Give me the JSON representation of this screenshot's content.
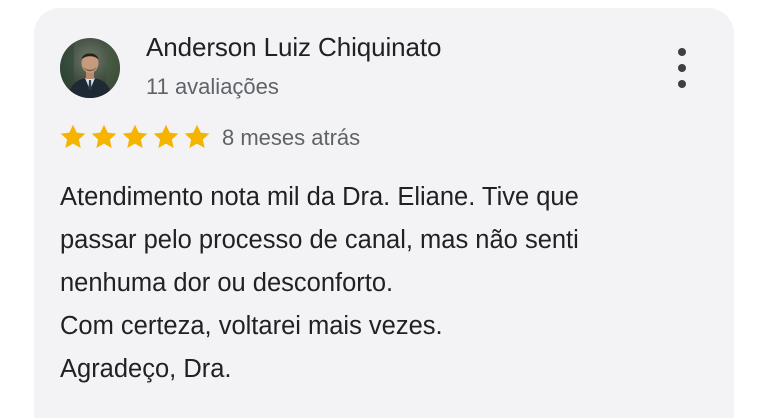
{
  "review": {
    "author_name": "Anderson Luiz Chiquinato",
    "reviews_count": "11 avaliações",
    "rating": 5,
    "max_rating": 5,
    "time_ago": "8 meses atrás",
    "text_lines": [
      "Atendimento nota mil da Dra. Eliane. Tive que",
      "passar pelo processo de canal, mas não senti",
      "nenhuma dor ou desconforto.",
      "Com certeza, voltarei mais vezes.",
      "Agradeço, Dra."
    ],
    "icons": {
      "avatar": "user-profile-photo",
      "menu": "more-vertical-icon",
      "star": "star-icon"
    },
    "colors": {
      "card_background": "#f3f3f6",
      "star": "#f5b400",
      "primary_text": "#202124",
      "secondary_text": "#5f6368"
    }
  }
}
